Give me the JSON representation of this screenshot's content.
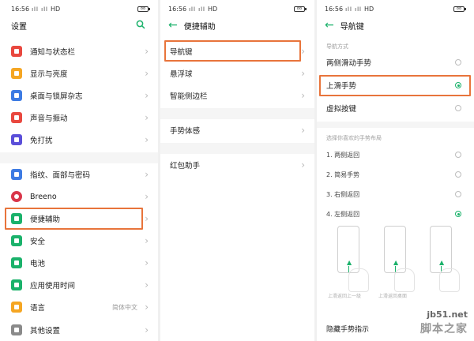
{
  "panel1": {
    "status": {
      "time": "16:56",
      "signal": "ıll ıll",
      "network": "HD",
      "battery": "88"
    },
    "title": "设置",
    "items": [
      {
        "label": "通知与状态栏",
        "icon": "notification-icon",
        "color": "#e9483f"
      },
      {
        "label": "显示与亮度",
        "icon": "brightness-icon",
        "color": "#f5a623"
      },
      {
        "label": "桌面与锁屏杂志",
        "icon": "wallpaper-icon",
        "color": "#3d7be3"
      },
      {
        "label": "声音与振动",
        "icon": "sound-icon",
        "color": "#e9483f"
      },
      {
        "label": "免打扰",
        "icon": "moon-icon",
        "color": "#5b4fd9"
      },
      {
        "label": "指纹、面部与密码",
        "icon": "fingerprint-icon",
        "color": "#3d7be3"
      },
      {
        "label": "Breeno",
        "icon": "breeno-icon",
        "color": "#d9364a"
      },
      {
        "label": "便捷辅助",
        "icon": "accessibility-icon",
        "color": "#1bb26b"
      },
      {
        "label": "安全",
        "icon": "shield-icon",
        "color": "#1bb26b"
      },
      {
        "label": "电池",
        "icon": "battery-icon",
        "color": "#1bb26b"
      },
      {
        "label": "应用使用时间",
        "icon": "app-time-icon",
        "color": "#1bb26b"
      },
      {
        "label": "语言",
        "icon": "language-icon",
        "color": "#f5a623",
        "value": "简体中文"
      },
      {
        "label": "其他设置",
        "icon": "more-settings-icon",
        "color": "#8a8a8a"
      }
    ]
  },
  "panel2": {
    "status": {
      "time": "16:56",
      "signal": "ıll ıll",
      "network": "HD",
      "battery": "88"
    },
    "title": "便捷辅助",
    "items": [
      {
        "label": "导航键"
      },
      {
        "label": "悬浮球"
      },
      {
        "label": "智能侧边栏"
      },
      {
        "label": "手势体感"
      },
      {
        "label": "红包助手"
      }
    ]
  },
  "panel3": {
    "status": {
      "time": "16:56",
      "signal": "ıll ıll",
      "network": "HD",
      "battery": "88"
    },
    "title": "导航键",
    "section1": "导航方式",
    "modes": [
      {
        "label": "两侧滑动手势",
        "selected": false
      },
      {
        "label": "上滑手势",
        "selected": true
      },
      {
        "label": "虚拟按键",
        "selected": false
      }
    ],
    "section2": "选择你喜欢的手势布局",
    "layouts": [
      {
        "label": "1. 两侧返回",
        "selected": false
      },
      {
        "label": "2. 简易手势",
        "selected": false
      },
      {
        "label": "3. 右侧返回",
        "selected": false
      },
      {
        "label": "4. 左侧返回",
        "selected": true
      }
    ],
    "gesture_captions": [
      "上滑返回上一级",
      "上滑返回桌面"
    ],
    "hidden_label": "隐藏手势指示",
    "watermark_url": "jb51.net",
    "watermark_logo": "脚本之家"
  }
}
